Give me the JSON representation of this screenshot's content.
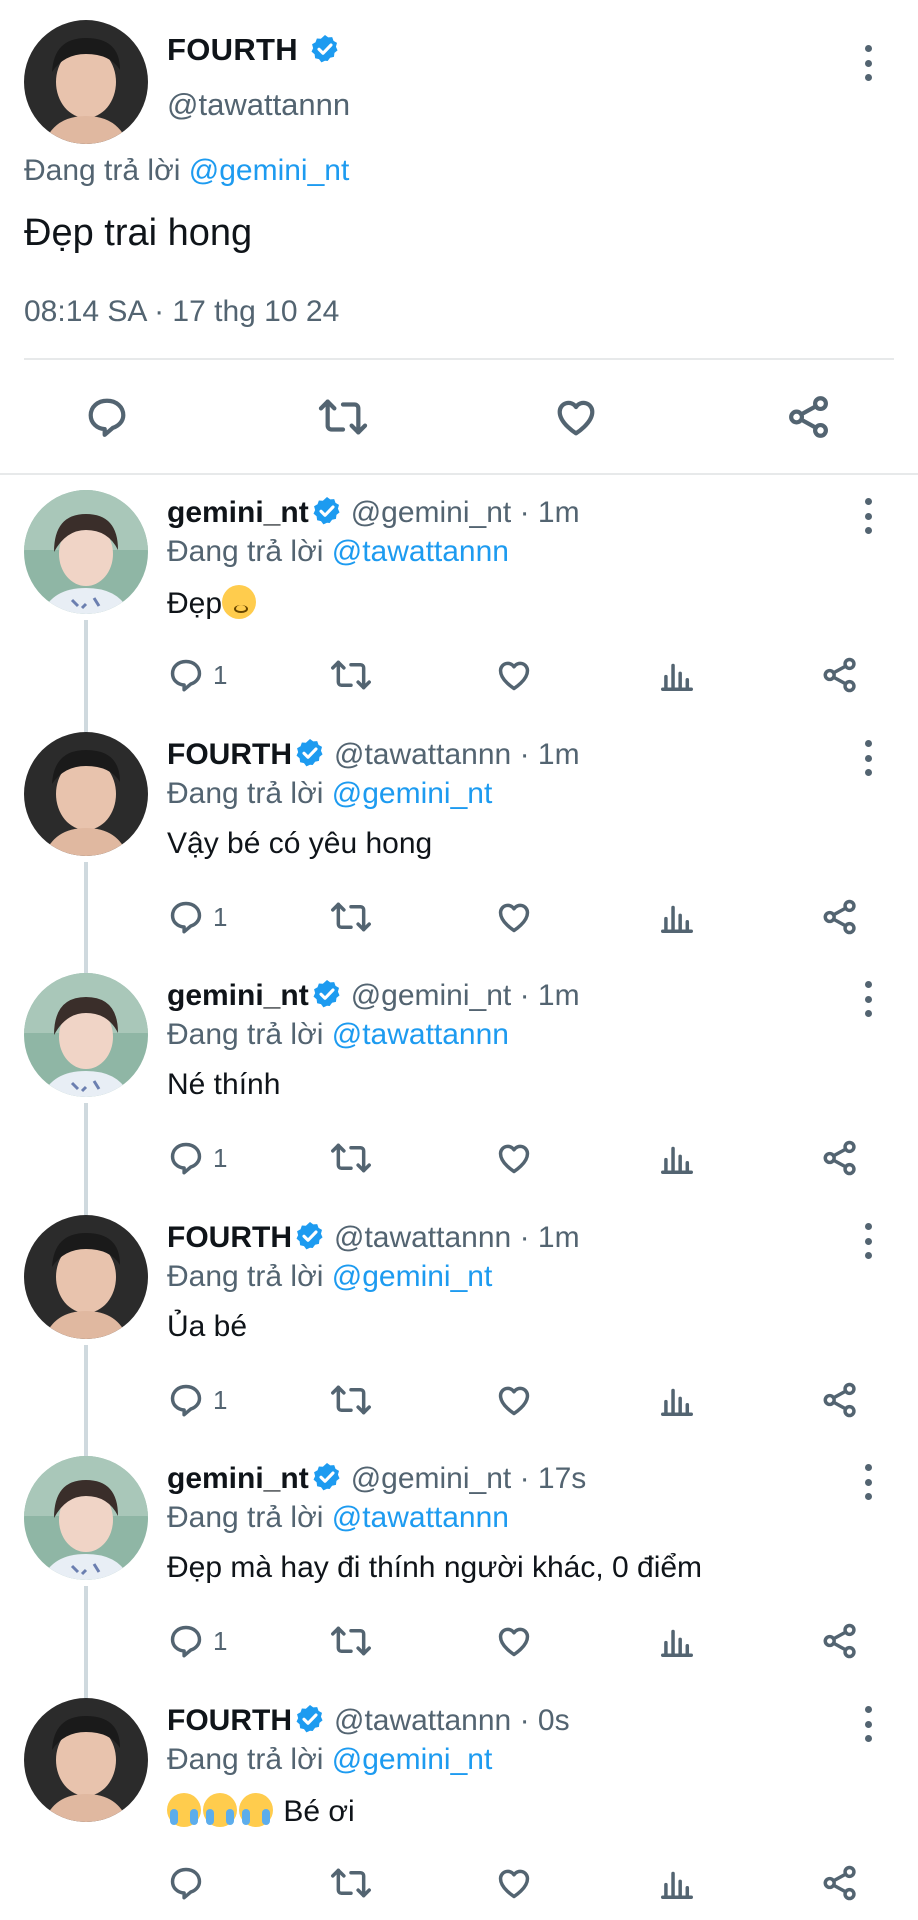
{
  "main_tweet": {
    "name": "FOURTH",
    "handle": "@tawattannn",
    "replying_prefix": "Đang trả lời",
    "replying_to": "@gemini_nt",
    "text": "Đẹp trai hong",
    "timestamp": "08:14 SA · 17 thg 10 24",
    "actions": [
      "reply-icon",
      "retweet-icon",
      "like-icon",
      "share-icon"
    ]
  },
  "replies": [
    {
      "name": "gemini_nt",
      "handle": "@gemini_nt",
      "time": "· 1m",
      "replying_prefix": "Đang trả lời",
      "replying_to": "@tawattannn",
      "text": "Đẹp",
      "emoji": "kissing-face",
      "reply_count": "1"
    },
    {
      "name": "FOURTH",
      "handle": "@tawattannn",
      "time": "· 1m",
      "replying_prefix": "Đang trả lời",
      "replying_to": "@gemini_nt",
      "text": "Vậy bé có yêu hong",
      "reply_count": "1"
    },
    {
      "name": "gemini_nt",
      "handle": "@gemini_nt",
      "time": "· 1m",
      "replying_prefix": "Đang trả lời",
      "replying_to": "@tawattannn",
      "text": "Né thính",
      "reply_count": "1"
    },
    {
      "name": "FOURTH",
      "handle": "@tawattannn",
      "time": "· 1m",
      "replying_prefix": "Đang trả lời",
      "replying_to": "@gemini_nt",
      "text": "Ủa bé",
      "reply_count": "1"
    },
    {
      "name": "gemini_nt",
      "handle": "@gemini_nt",
      "time": "· 17s",
      "replying_prefix": "Đang trả lời",
      "replying_to": "@tawattannn",
      "text": "Đẹp mà hay đi thính người khác, 0 điểm",
      "reply_count": "1"
    },
    {
      "name": "FOURTH",
      "handle": "@tawattannn",
      "time": "· 0s",
      "replying_prefix": "Đang trả lời",
      "replying_to": "@gemini_nt",
      "text": "Bé ơi",
      "emoji": "crying-face ×3",
      "reply_count": ""
    }
  ],
  "colors": {
    "link": "#1d9bf0",
    "secondary": "#536471",
    "verified": "#1d9bf0",
    "divider": "#e7e9ea"
  }
}
